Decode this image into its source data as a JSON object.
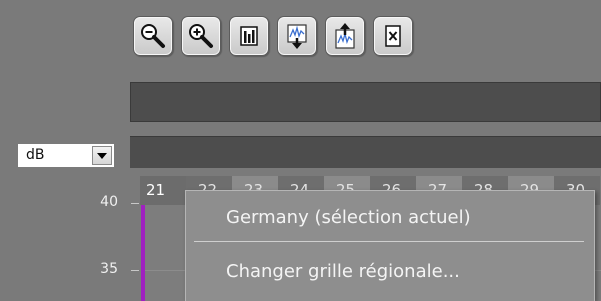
{
  "toolbar": {
    "buttons": [
      {
        "name": "zoom-out-button",
        "icon": "zoom-out-icon"
      },
      {
        "name": "zoom-in-button",
        "icon": "zoom-in-icon"
      },
      {
        "name": "bar-chart-button",
        "icon": "bar-chart-icon"
      },
      {
        "name": "import-button",
        "icon": "import-graph-icon"
      },
      {
        "name": "export-button",
        "icon": "export-graph-icon"
      },
      {
        "name": "clear-button",
        "icon": "close-box-icon"
      }
    ]
  },
  "unit_select": {
    "value": "dB",
    "icon": "chevron-down-icon"
  },
  "channels": [
    "21",
    "22",
    "23",
    "24",
    "25",
    "26",
    "27",
    "28",
    "29",
    "30"
  ],
  "y_axis": {
    "ticks": [
      "40",
      "35"
    ]
  },
  "context_menu": {
    "items": [
      {
        "label": "Germany (sélection actuel)"
      },
      {
        "label": "Changer grille régionale..."
      }
    ]
  },
  "colors": {
    "background": "#7a7a7a",
    "dark_bar": "#4d4d4d",
    "marker": "#a020c0",
    "menu": "#8e8e8e"
  }
}
